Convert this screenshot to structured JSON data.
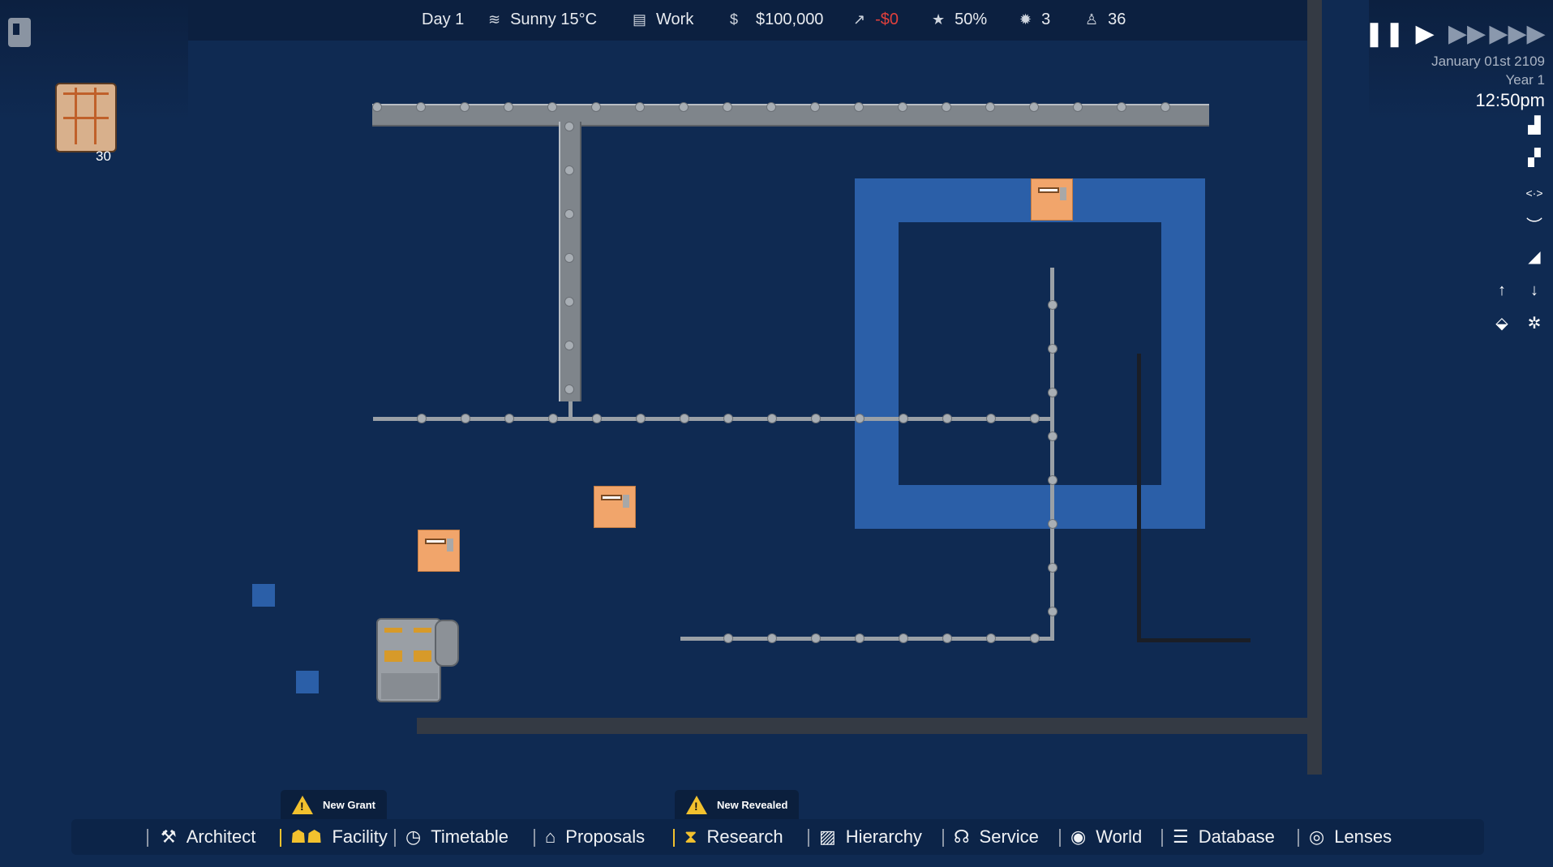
{
  "topbar": {
    "day": "Day 1",
    "weather": "Sunny 15°C",
    "schedule": "Work",
    "money": "$100,000",
    "income": "-$0",
    "rating": "50%",
    "bugs": "3",
    "staff": "36",
    "icons": [
      "wind-icon",
      "clipboard-icon",
      "dollar-icon",
      "trend-icon",
      "star-icon",
      "bug-icon",
      "person-icon"
    ]
  },
  "inventory": {
    "count": "30",
    "icon": "crate-stack-icon"
  },
  "clock": {
    "date": "January 01st 2109",
    "year": "Year 1",
    "time": "12:50pm",
    "speeds": [
      "pause-icon",
      "play-icon",
      "fast-forward-icon",
      "fastest-icon"
    ]
  },
  "notifications": [
    {
      "text": "New Grant"
    },
    {
      "text": "New Revealed"
    }
  ],
  "nav": [
    {
      "label": "Architect",
      "icon": "tools-icon"
    },
    {
      "label": "Facility",
      "icon": "people-icon"
    },
    {
      "label": "Timetable",
      "icon": "clock-icon"
    },
    {
      "label": "Proposals",
      "icon": "bank-icon"
    },
    {
      "label": "Research",
      "icon": "hourglass-icon"
    },
    {
      "label": "Hierarchy",
      "icon": "chart-icon"
    },
    {
      "label": "Service",
      "icon": "headset-icon"
    },
    {
      "label": "World",
      "icon": "globe-icon"
    },
    {
      "label": "Database",
      "icon": "list-icon"
    },
    {
      "label": "Lenses",
      "icon": "eye-icon"
    }
  ],
  "colors": {
    "background": "#0f2a52",
    "floor_tile": "#2b5fa8",
    "door": "#f1a56b",
    "negative": "#e0403c",
    "accent": "#f2c12e"
  }
}
